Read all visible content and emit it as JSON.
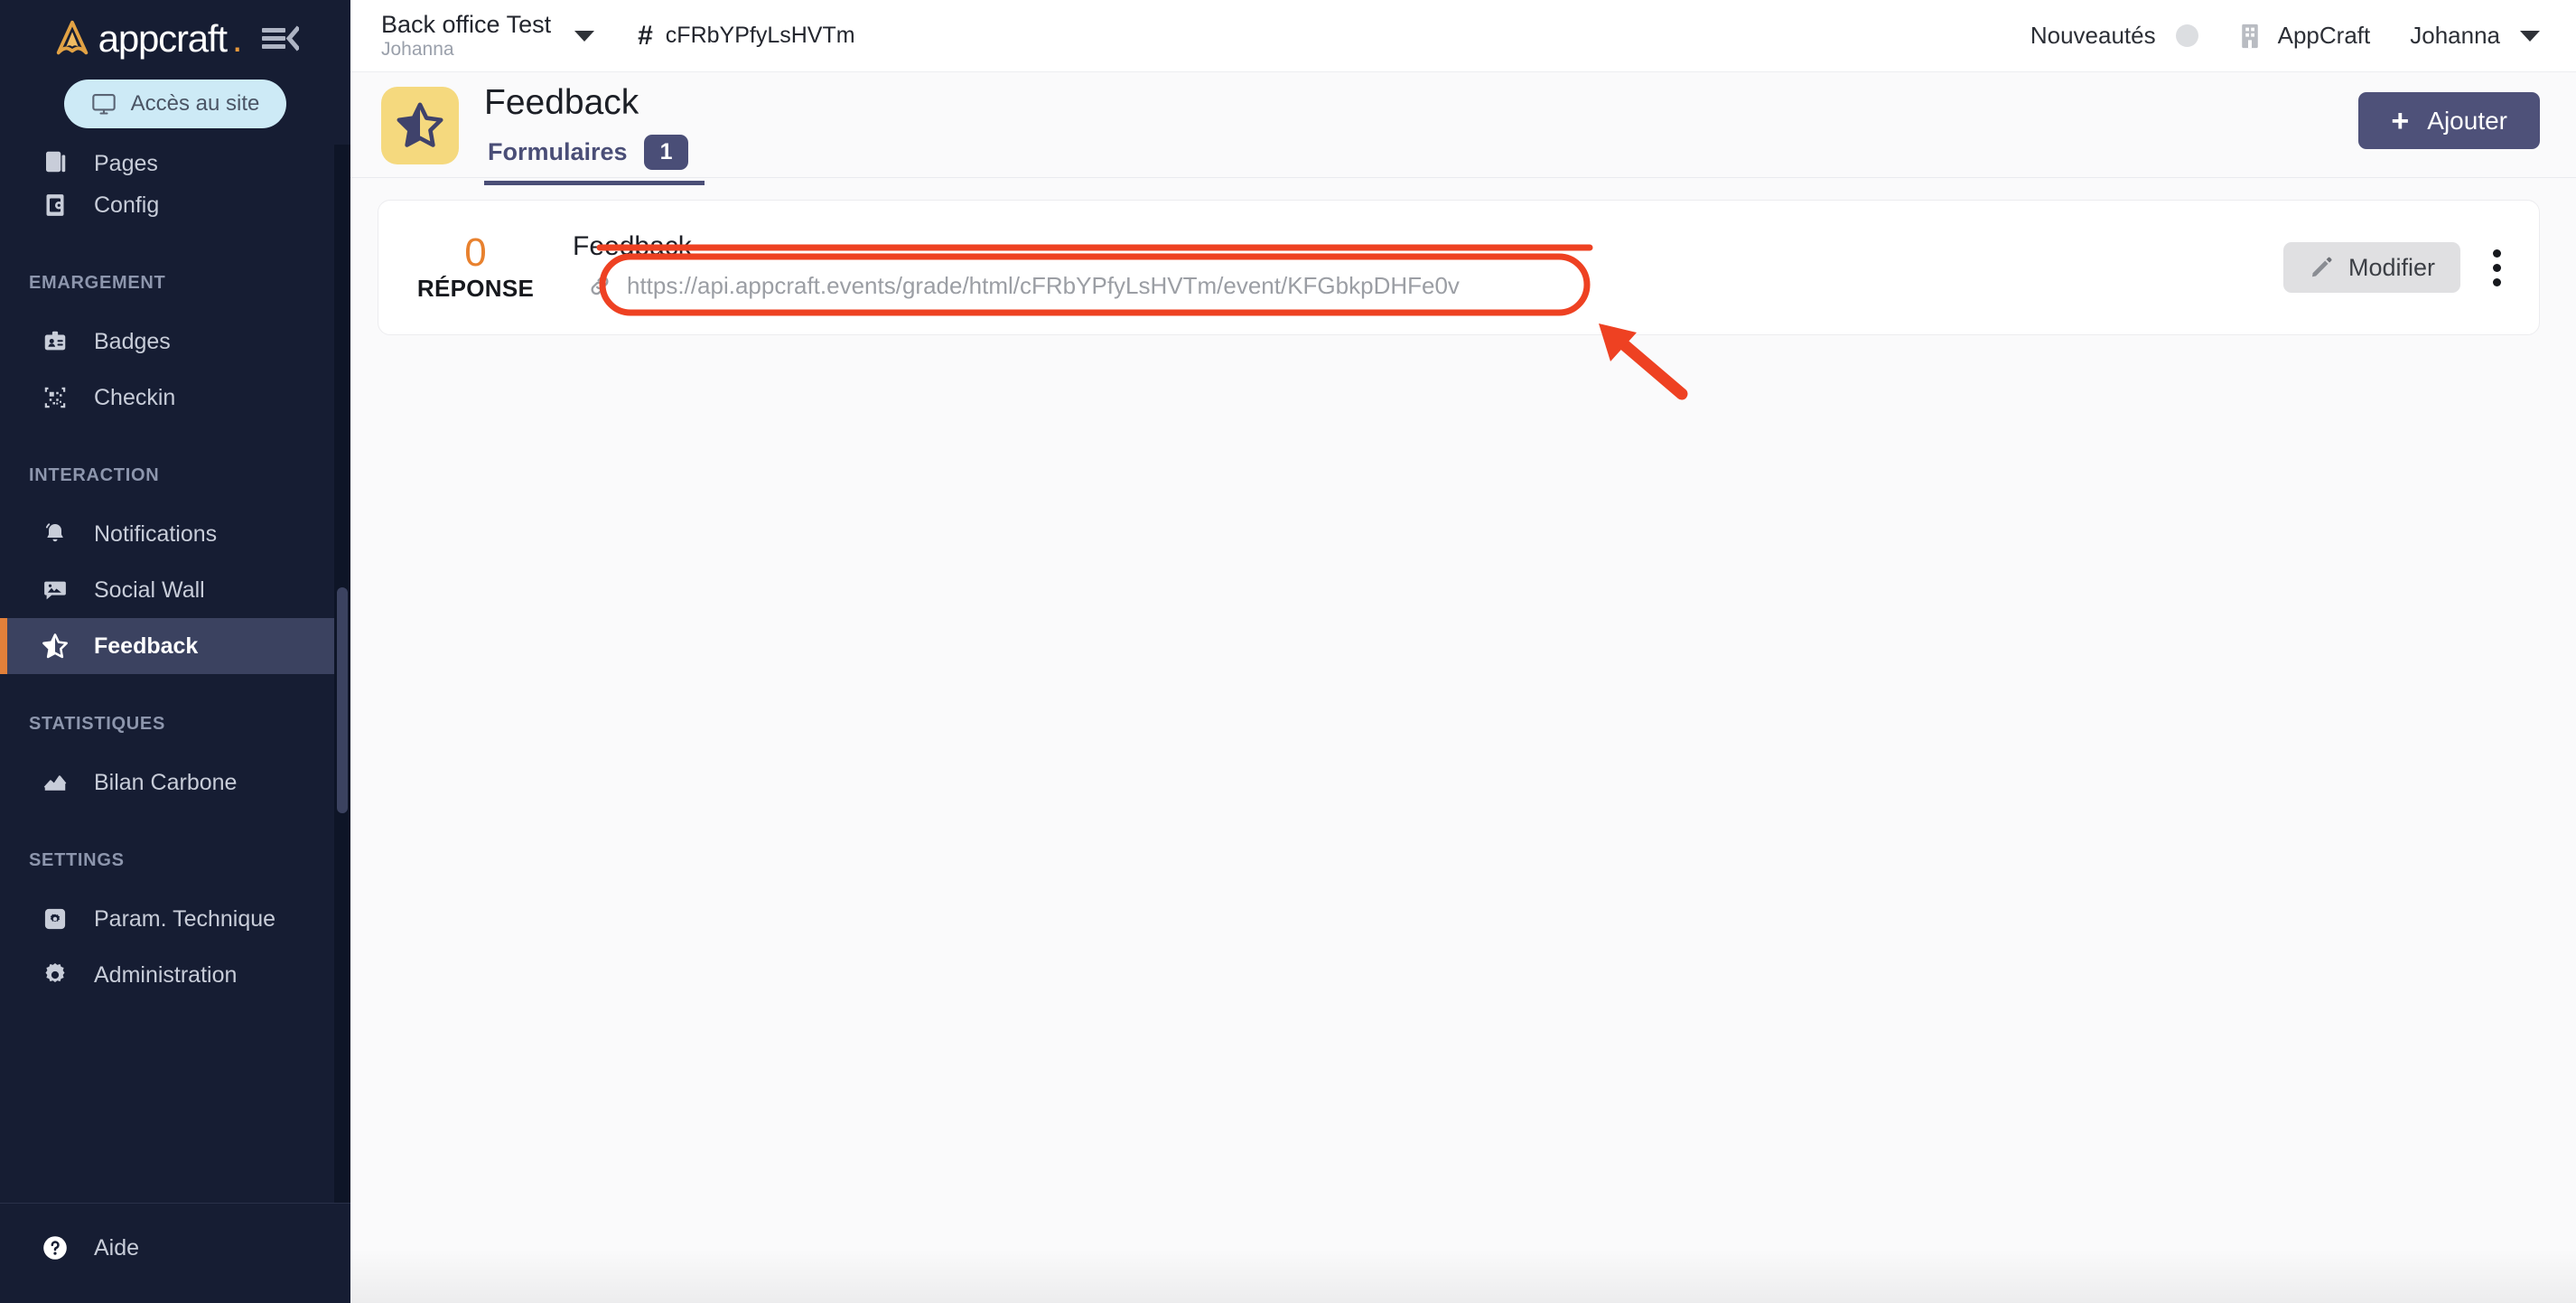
{
  "brand": {
    "name": "appcraft",
    "dot": ".",
    "logo_icon": "appcraft-logo-icon",
    "collapse_icon": "menu-collapse-icon"
  },
  "sidebar": {
    "site_button": {
      "label": "Accès au site",
      "icon": "monitor-icon"
    },
    "groups": [
      {
        "label": "",
        "items": [
          {
            "label": "Pages",
            "icon": "pages-icon",
            "active": false,
            "clipped": true
          },
          {
            "label": "Config",
            "icon": "phone-config-icon",
            "active": false,
            "clipped": false
          }
        ]
      },
      {
        "label": "EMARGEMENT",
        "items": [
          {
            "label": "Badges",
            "icon": "badge-icon",
            "active": false,
            "clipped": false
          },
          {
            "label": "Checkin",
            "icon": "qrcode-icon",
            "active": false,
            "clipped": false
          }
        ]
      },
      {
        "label": "INTERACTION",
        "items": [
          {
            "label": "Notifications",
            "icon": "bell-icon",
            "active": false,
            "clipped": false
          },
          {
            "label": "Social Wall",
            "icon": "image-chat-icon",
            "active": false,
            "clipped": false
          },
          {
            "label": "Feedback",
            "icon": "star-half-icon",
            "active": true,
            "clipped": false
          }
        ]
      },
      {
        "label": "STATISTIQUES",
        "items": [
          {
            "label": "Bilan Carbone",
            "icon": "chart-area-icon",
            "active": false,
            "clipped": false
          }
        ]
      },
      {
        "label": "SETTINGS",
        "items": [
          {
            "label": "Param. Technique",
            "icon": "gear-square-icon",
            "active": false,
            "clipped": false
          },
          {
            "label": "Administration",
            "icon": "gear-icon",
            "active": false,
            "clipped": false
          }
        ]
      }
    ],
    "footer": {
      "label": "Aide",
      "icon": "question-circle-icon"
    }
  },
  "topbar": {
    "workspace": {
      "name": "Back office Test",
      "sub": "Johanna",
      "caret_icon": "chevron-down-icon"
    },
    "event": {
      "hash": "#",
      "code": "cFRbYPfyLsHVTm"
    },
    "news": {
      "label": "Nouveautés",
      "dot_icon": "status-dot-icon"
    },
    "org": {
      "label": "AppCraft",
      "icon": "building-icon"
    },
    "user": {
      "label": "Johanna",
      "caret_icon": "chevron-down-icon"
    }
  },
  "pagehead": {
    "icon": "star-half-icon",
    "title": "Feedback",
    "tabs": [
      {
        "label": "Formulaires",
        "badge": "1",
        "active": true
      }
    ],
    "add_button": {
      "label": "Ajouter",
      "icon": "plus-icon"
    }
  },
  "card": {
    "response_count": "0",
    "response_label": "RÉPONSE",
    "title": "Feedback",
    "url": "https://api.appcraft.events/grade/html/cFRbYPfyLsHVTm/event/KFGbkpDHFe0v",
    "url_icon": "link-icon",
    "edit_button": {
      "label": "Modifier",
      "icon": "pencil-icon"
    },
    "menu_icon": "kebab-menu-icon"
  },
  "annotation": {
    "highlight_color": "#EE4122",
    "shapes": [
      "url-field-highlight-oval",
      "pointer-arrow",
      "title-underline"
    ]
  },
  "colors": {
    "sidebar_bg": "#161D33",
    "sidebar_active_bg": "#3B4260",
    "accent_orange": "#E2803A",
    "brand_purple": "#4E5179",
    "response_orange": "#E8812E",
    "site_btn_bg": "#CDEAF6",
    "page_icon_bg": "#F5D97E"
  }
}
